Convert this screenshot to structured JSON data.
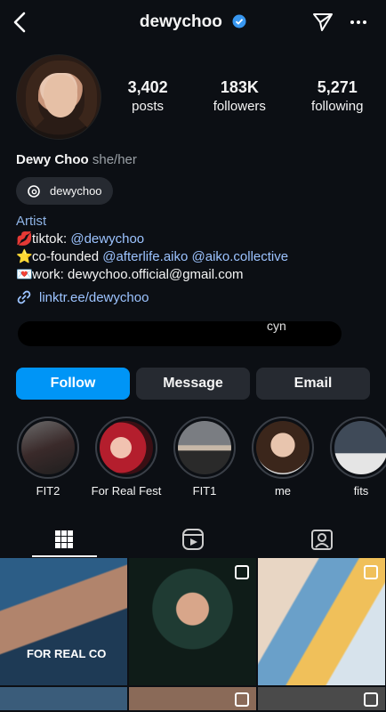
{
  "profile": {
    "username": "dewychoo",
    "display_name": "Dewy Choo",
    "pronouns": "she/her",
    "threads_handle": "dewychoo",
    "category": "Artist",
    "bio_lines": [
      {
        "emoji": "💋",
        "prefix": "tiktok: ",
        "link": "@dewychoo",
        "suffix": ""
      },
      {
        "emoji": "⭐",
        "prefix": "co-founded ",
        "link": "@afterlife.aiko @aiko.collective",
        "suffix": ""
      },
      {
        "emoji": "💌",
        "prefix": "work: dewychoo.official@gmail.com",
        "link": "",
        "suffix": ""
      }
    ],
    "link": "linktr.ee/dewychoo",
    "mutual_fragment": "cyn"
  },
  "stats": {
    "posts_count": "3,402",
    "posts_label": "posts",
    "followers_count": "183K",
    "followers_label": "followers",
    "following_count": "5,271",
    "following_label": "following"
  },
  "buttons": {
    "follow": "Follow",
    "message": "Message",
    "email": "Email"
  },
  "highlights": [
    {
      "label": "FIT2"
    },
    {
      "label": "For Real Fest"
    },
    {
      "label": "FIT1"
    },
    {
      "label": "me"
    },
    {
      "label": "fits"
    }
  ],
  "grid": {
    "post1_overlay": "FOR REAL CO"
  },
  "colors": {
    "accent": "#0095f6",
    "background": "#0c0f14",
    "link": "#9cc3ff"
  }
}
